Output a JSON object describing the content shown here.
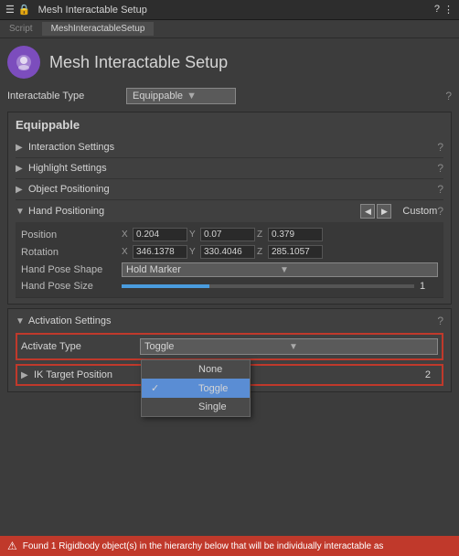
{
  "titleBar": {
    "title": "Mesh Interactable Setup",
    "icons": [
      "menu-icon",
      "lock-icon"
    ],
    "rightIcons": [
      "help-icon",
      "more-icon"
    ]
  },
  "tabs": [
    {
      "label": "Script",
      "active": false
    },
    {
      "label": "MeshInteractableSetup",
      "active": true
    }
  ],
  "header": {
    "title": "Mesh Interactable Setup"
  },
  "interactableType": {
    "label": "Interactable Type",
    "value": "Equippable"
  },
  "equippable": {
    "title": "Equippable"
  },
  "sections": {
    "interactionSettings": {
      "label": "Interaction Settings",
      "collapsed": true
    },
    "highlightSettings": {
      "label": "Highlight Settings",
      "collapsed": true
    },
    "objectPositioning": {
      "label": "Object Positioning",
      "collapsed": true
    },
    "handPositioning": {
      "label": "Hand Positioning",
      "collapsed": false,
      "navValue": "Custom",
      "position": {
        "label": "Position",
        "x": "0.204",
        "y": "0.07",
        "z": "0.379"
      },
      "rotation": {
        "label": "Rotation",
        "x": "346.1378",
        "y": "330.4046",
        "z": "285.1057"
      },
      "handPoseShape": {
        "label": "Hand Pose Shape",
        "value": "Hold Marker"
      },
      "handPoseSize": {
        "label": "Hand Pose Size",
        "value": "1"
      }
    }
  },
  "activationSettings": {
    "title": "Activation Settings",
    "activateType": {
      "label": "Activate Type",
      "value": "Toggle",
      "options": [
        {
          "label": "None",
          "selected": false
        },
        {
          "label": "Toggle",
          "selected": true
        },
        {
          "label": "Single",
          "selected": false
        }
      ]
    },
    "ikTargetPosition": {
      "label": "IK Target Position",
      "value": "2"
    }
  },
  "statusBar": {
    "icon": "⚠",
    "message": "Found 1 Rigidbody object(s) in the hierarchy below that will be individually interactable as"
  },
  "colors": {
    "accent": "#7c4dbd",
    "error": "#c0392b",
    "selected": "#5a8dd4"
  }
}
